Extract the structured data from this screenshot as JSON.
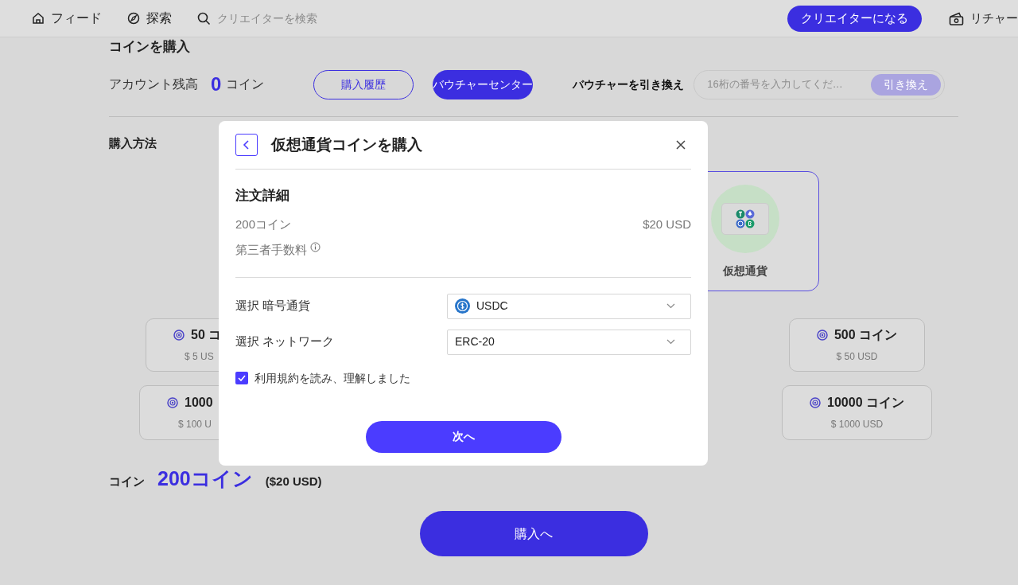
{
  "nav": {
    "items": [
      {
        "kind": "home",
        "label": "フィード"
      },
      {
        "kind": "explore",
        "label": "探索"
      }
    ],
    "search": {
      "placeholder": "クリエイターを検索"
    },
    "become_creator": "クリエイターになる",
    "recharge": "リチャー"
  },
  "page": {
    "title": "コインを購入",
    "balance_label": "アカウント残高",
    "balance": "0",
    "balance_unit": "コイン",
    "history_button": "購入履歴",
    "voucher_center_button": "バウチャーセンター",
    "redeem_label": "バウチャーを引き換え",
    "voucher_field": {
      "placeholder": "16桁の番号を入力してくだ…"
    },
    "redeem_button": "引き換え",
    "method_label": "購入方法",
    "methods": [
      {
        "label": "仮想通貨",
        "selected": true
      }
    ],
    "coin_cards": [
      {
        "coins": "50 コ",
        "price": "$ 5 US"
      },
      {
        "coins": "500 コイン",
        "price": "$ 50 USD"
      },
      {
        "coins": "1000",
        "price": "$ 100 U"
      },
      {
        "coins": "10000 コイン",
        "price": "$ 1000 USD"
      }
    ],
    "summary_label": "コイン",
    "summary_coins": "200コイン",
    "summary_price": "($20 USD)",
    "buy_button": "購入へ"
  },
  "modal": {
    "title": "仮想通貨コインを購入",
    "section": "注文詳細",
    "order_item": "200コイン",
    "order_price": "$20 USD",
    "fee_label": "第三者手数料",
    "selects": [
      {
        "label": "選択 暗号通貨",
        "value": "USDC",
        "kind": "coin"
      },
      {
        "label": "選択 ネットワーク",
        "value": "ERC-20",
        "kind": "plain"
      }
    ],
    "terms": {
      "label": "利用規約を読み、理解しました",
      "checked": true
    },
    "next_button": "次へ"
  }
}
